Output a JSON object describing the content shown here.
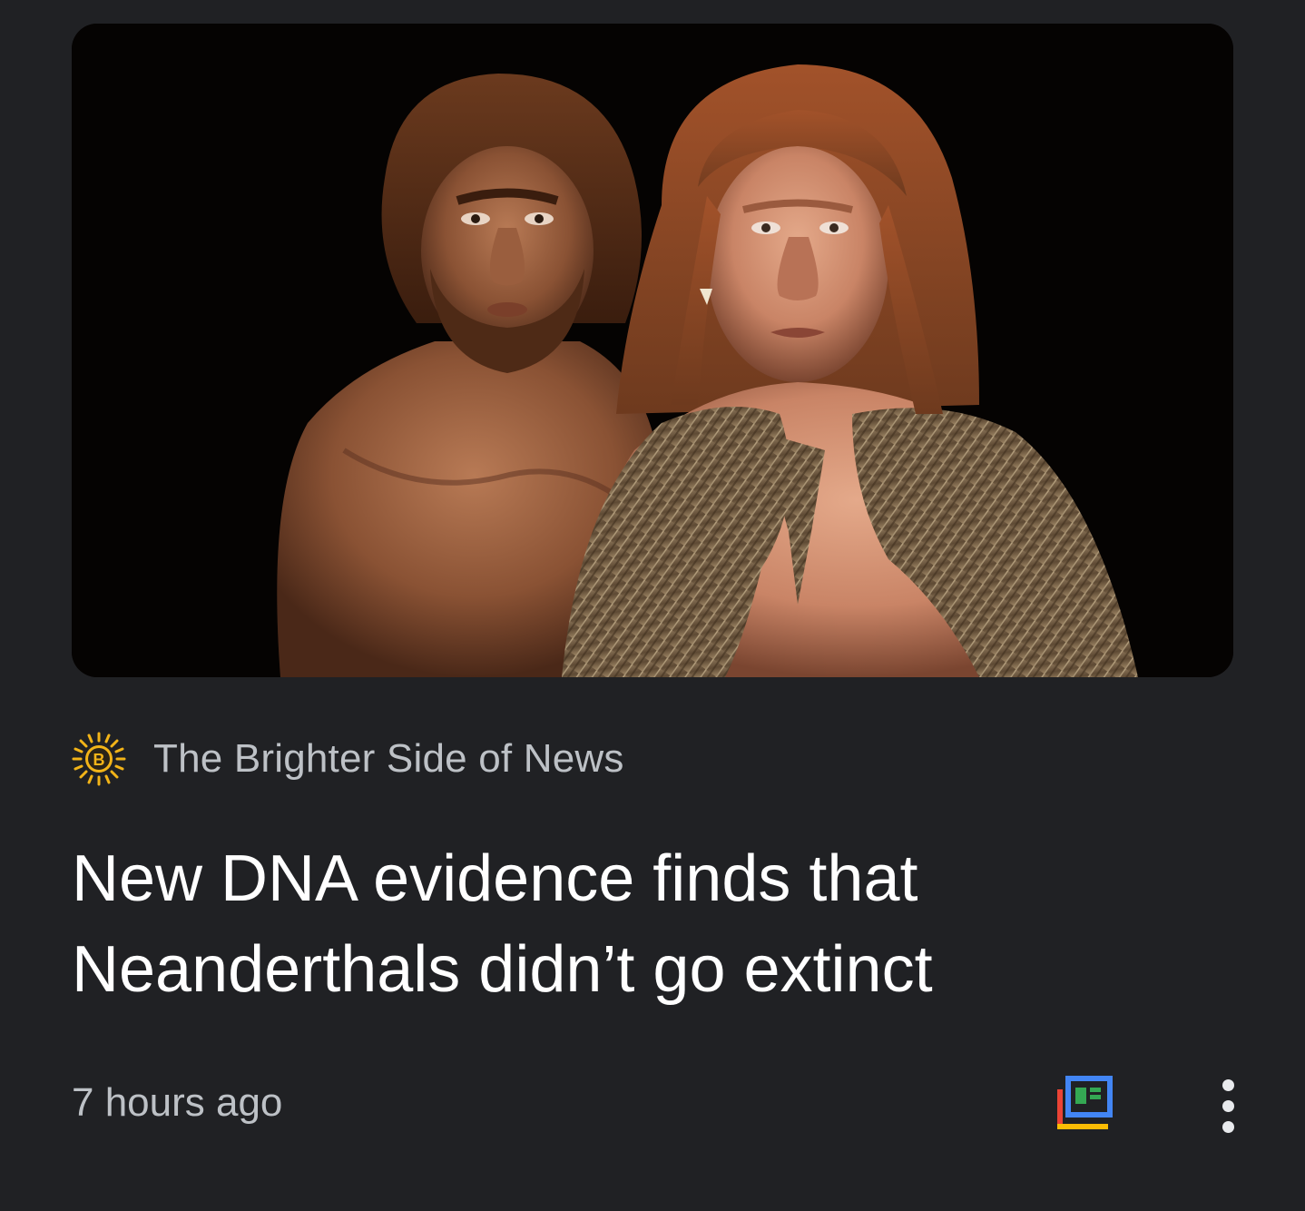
{
  "article": {
    "image_alt": "Reconstruction of a Neanderthal man and woman",
    "source": {
      "name": "The Brighter Side of News",
      "logo_letter": "B",
      "logo_color": "#f2b418"
    },
    "headline": "New DNA evidence finds that Neanderthals didn’t go extinct",
    "timestamp": "7 hours ago",
    "actions": {
      "full_coverage_icon": "full-coverage-icon",
      "more_icon": "more-vert-icon"
    }
  },
  "colors": {
    "background": "#202124",
    "headline": "#ffffff",
    "secondary_text": "#bdc1c6",
    "google_blue": "#4285f4",
    "google_red": "#ea4335",
    "google_yellow": "#fbbc04",
    "google_green": "#34a853"
  }
}
